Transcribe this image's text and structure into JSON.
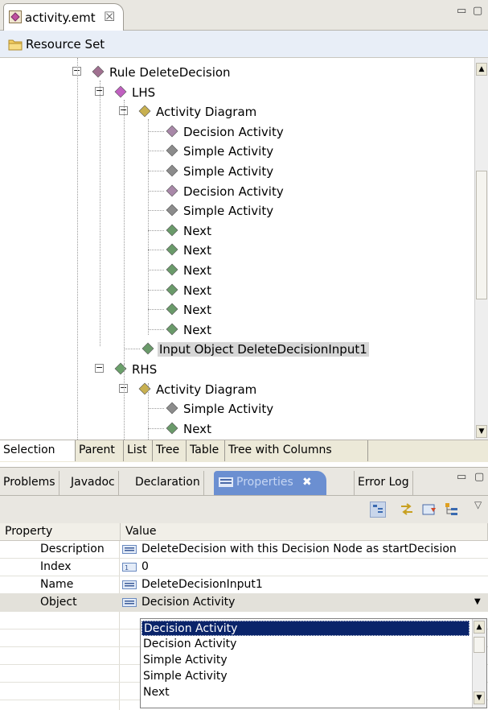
{
  "editor": {
    "tab_title": "activity.emt",
    "tab_close": "☒",
    "minimize": "▭",
    "maximize": "▢"
  },
  "resource_set": {
    "label": "Resource Set"
  },
  "tree": {
    "items": [
      {
        "label": "Rule DeleteDecision",
        "icon": "rule-diamond-icon",
        "color": "#a07090"
      },
      {
        "label": "LHS",
        "icon": "lhs-diamond-icon",
        "color": "#c060c0"
      },
      {
        "label": "Activity Diagram",
        "icon": "diagram-diamond-icon",
        "color": "#c8b050"
      },
      {
        "label": "Decision Activity",
        "icon": "decision-diamond-icon",
        "color": "#a888a8"
      },
      {
        "label": "Simple Activity",
        "icon": "simple-diamond-icon",
        "color": "#8c8c8c"
      },
      {
        "label": "Simple Activity",
        "icon": "simple-diamond-icon",
        "color": "#8c8c8c"
      },
      {
        "label": "Decision Activity",
        "icon": "decision-diamond-icon",
        "color": "#a888a8"
      },
      {
        "label": "Simple Activity",
        "icon": "simple-diamond-icon",
        "color": "#8c8c8c"
      },
      {
        "label": "Next",
        "icon": "next-diamond-icon",
        "color": "#6a9a6a"
      },
      {
        "label": "Next",
        "icon": "next-diamond-icon",
        "color": "#6a9a6a"
      },
      {
        "label": "Next",
        "icon": "next-diamond-icon",
        "color": "#6a9a6a"
      },
      {
        "label": "Next",
        "icon": "next-diamond-icon",
        "color": "#6a9a6a"
      },
      {
        "label": "Next",
        "icon": "next-diamond-icon",
        "color": "#6a9a6a"
      },
      {
        "label": "Next",
        "icon": "next-diamond-icon",
        "color": "#6a9a6a"
      },
      {
        "label": "Input Object DeleteDecisionInput1",
        "icon": "input-diamond-icon",
        "color": "#6a9a6a"
      },
      {
        "label": "RHS",
        "icon": "rhs-diamond-icon",
        "color": "#6aa06a"
      },
      {
        "label": "Activity Diagram",
        "icon": "diagram-diamond-icon",
        "color": "#c8b050"
      },
      {
        "label": "Simple Activity",
        "icon": "simple-diamond-icon",
        "color": "#8c8c8c"
      },
      {
        "label": "Next",
        "icon": "next-diamond-icon",
        "color": "#6a9a6a"
      }
    ]
  },
  "page_tabs": [
    "Selection",
    "Parent",
    "List",
    "Tree",
    "Table",
    "Tree with Columns"
  ],
  "views": {
    "tabs": [
      "Problems",
      "Javadoc",
      "Declaration",
      "Properties",
      "Error Log"
    ],
    "properties_close": "✖"
  },
  "properties": {
    "header_property": "Property",
    "header_value": "Value",
    "rows": [
      {
        "name": "Description",
        "value": "DeleteDecision with this Decision Node as startDecision"
      },
      {
        "name": "Index",
        "value": "0"
      },
      {
        "name": "Name",
        "value": "DeleteDecisionInput1"
      },
      {
        "name": "Object",
        "value": "Decision Activity"
      }
    ],
    "dropdown_options": [
      "Decision Activity",
      "Decision Activity",
      "Simple Activity",
      "Simple Activity",
      "Next"
    ]
  }
}
